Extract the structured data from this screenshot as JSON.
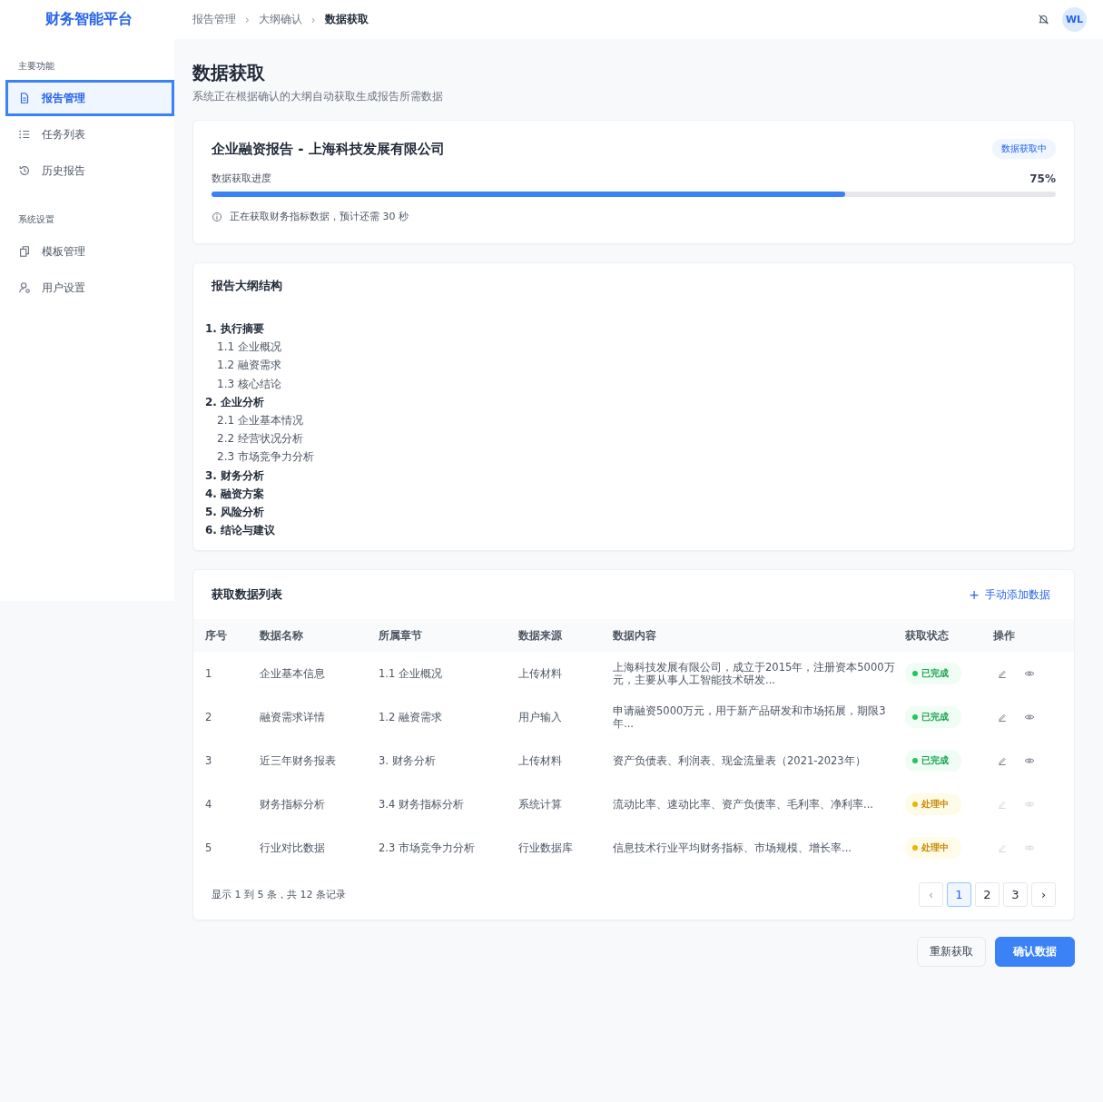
{
  "app": {
    "title": "财务智能平台"
  },
  "breadcrumb": [
    {
      "label": "报告管理",
      "current": false
    },
    {
      "label": "大纲确认",
      "current": false
    },
    {
      "label": "数据获取",
      "current": true
    }
  ],
  "breadcrumb_separator": "›",
  "user": {
    "initials": "WL"
  },
  "sidebar": [
    {
      "heading": "主要功能",
      "items": [
        {
          "label": "报告管理",
          "kind": "document",
          "selected": true
        },
        {
          "label": "任务列表",
          "kind": "list",
          "selected": false
        },
        {
          "label": "历史报告",
          "kind": "history",
          "selected": false
        }
      ]
    },
    {
      "heading": "系统设置",
      "items": [
        {
          "label": "模板管理",
          "kind": "copy",
          "selected": false
        },
        {
          "label": "用户设置",
          "kind": "user",
          "selected": false
        }
      ]
    }
  ],
  "page": {
    "title": "数据获取",
    "subtitle": "系统正在根据确认的大纲自动获取生成报告所需数据"
  },
  "progress_card": {
    "title": "企业融资报告 - 上海科技发展有限公司",
    "badge": "数据获取中",
    "label": "数据获取进度",
    "reading": "75%",
    "level": 0.75,
    "note": "正在获取财务指标数据，预计还需 30 秒"
  },
  "outline": {
    "title": "报告大纲结构",
    "items": [
      {
        "label": "1. 执行摘要",
        "children": [
          {
            "label": "1.1 企业概况"
          },
          {
            "label": "1.2 融资需求"
          },
          {
            "label": "1.3 核心结论"
          }
        ]
      },
      {
        "label": "2. 企业分析",
        "children": [
          {
            "label": "2.1 企业基本情况"
          },
          {
            "label": "2.2 经营状况分析"
          },
          {
            "label": "2.3 市场竞争力分析"
          }
        ]
      },
      {
        "label": "3. 财务分析"
      },
      {
        "label": "4. 融资方案"
      },
      {
        "label": "5. 风险分析"
      },
      {
        "label": "6. 结论与建议"
      }
    ]
  },
  "data_table": {
    "title": "获取数据列表",
    "add_button": "手动添加数据",
    "add_icon": "+",
    "columns": [
      "序号",
      "数据名称",
      "所属章节",
      "数据来源",
      "数据内容",
      "获取状态",
      "操作"
    ],
    "rows": [
      {
        "index": "1",
        "name": "企业基本信息",
        "section": "1.1 企业概况",
        "source": "上传材料",
        "content": "上海科技发展有限公司，成立于2015年，注册资本5000万元，主要从事人工智能技术研发...",
        "status": {
          "label": "已完成",
          "kind": "done"
        },
        "actions_enabled": true
      },
      {
        "index": "2",
        "name": "融资需求详情",
        "section": "1.2 融资需求",
        "source": "用户输入",
        "content": "申请融资5000万元，用于新产品研发和市场拓展，期限3年...",
        "status": {
          "label": "已完成",
          "kind": "done"
        },
        "actions_enabled": true
      },
      {
        "index": "3",
        "name": "近三年财务报表",
        "section": "3. 财务分析",
        "source": "上传材料",
        "content": "资产负债表、利润表、现金流量表（2021-2023年）",
        "status": {
          "label": "已完成",
          "kind": "done"
        },
        "actions_enabled": true
      },
      {
        "index": "4",
        "name": "财务指标分析",
        "section": "3.4 财务指标分析",
        "source": "系统计算",
        "content": "流动比率、速动比率、资产负债率、毛利率、净利率...",
        "status": {
          "label": "处理中",
          "kind": "processing"
        },
        "actions_enabled": false
      },
      {
        "index": "5",
        "name": "行业对比数据",
        "section": "2.3 市场竞争力分析",
        "source": "行业数据库",
        "content": "信息技术行业平均财务指标、市场规模、增长率...",
        "status": {
          "label": "处理中",
          "kind": "processing"
        },
        "actions_enabled": false
      }
    ],
    "summary": "显示 1 到 5 条，共 12 条记录",
    "pagination": {
      "prev": {
        "label": "‹",
        "disabled": true
      },
      "pages": [
        {
          "label": "1",
          "selected": true
        },
        {
          "label": "2",
          "selected": false
        },
        {
          "label": "3",
          "selected": false
        }
      ],
      "next": {
        "label": "›",
        "disabled": false
      }
    }
  },
  "buttons": [
    {
      "label": "重新获取",
      "kind": "secondary"
    },
    {
      "label": "确认数据",
      "kind": "primary"
    }
  ]
}
